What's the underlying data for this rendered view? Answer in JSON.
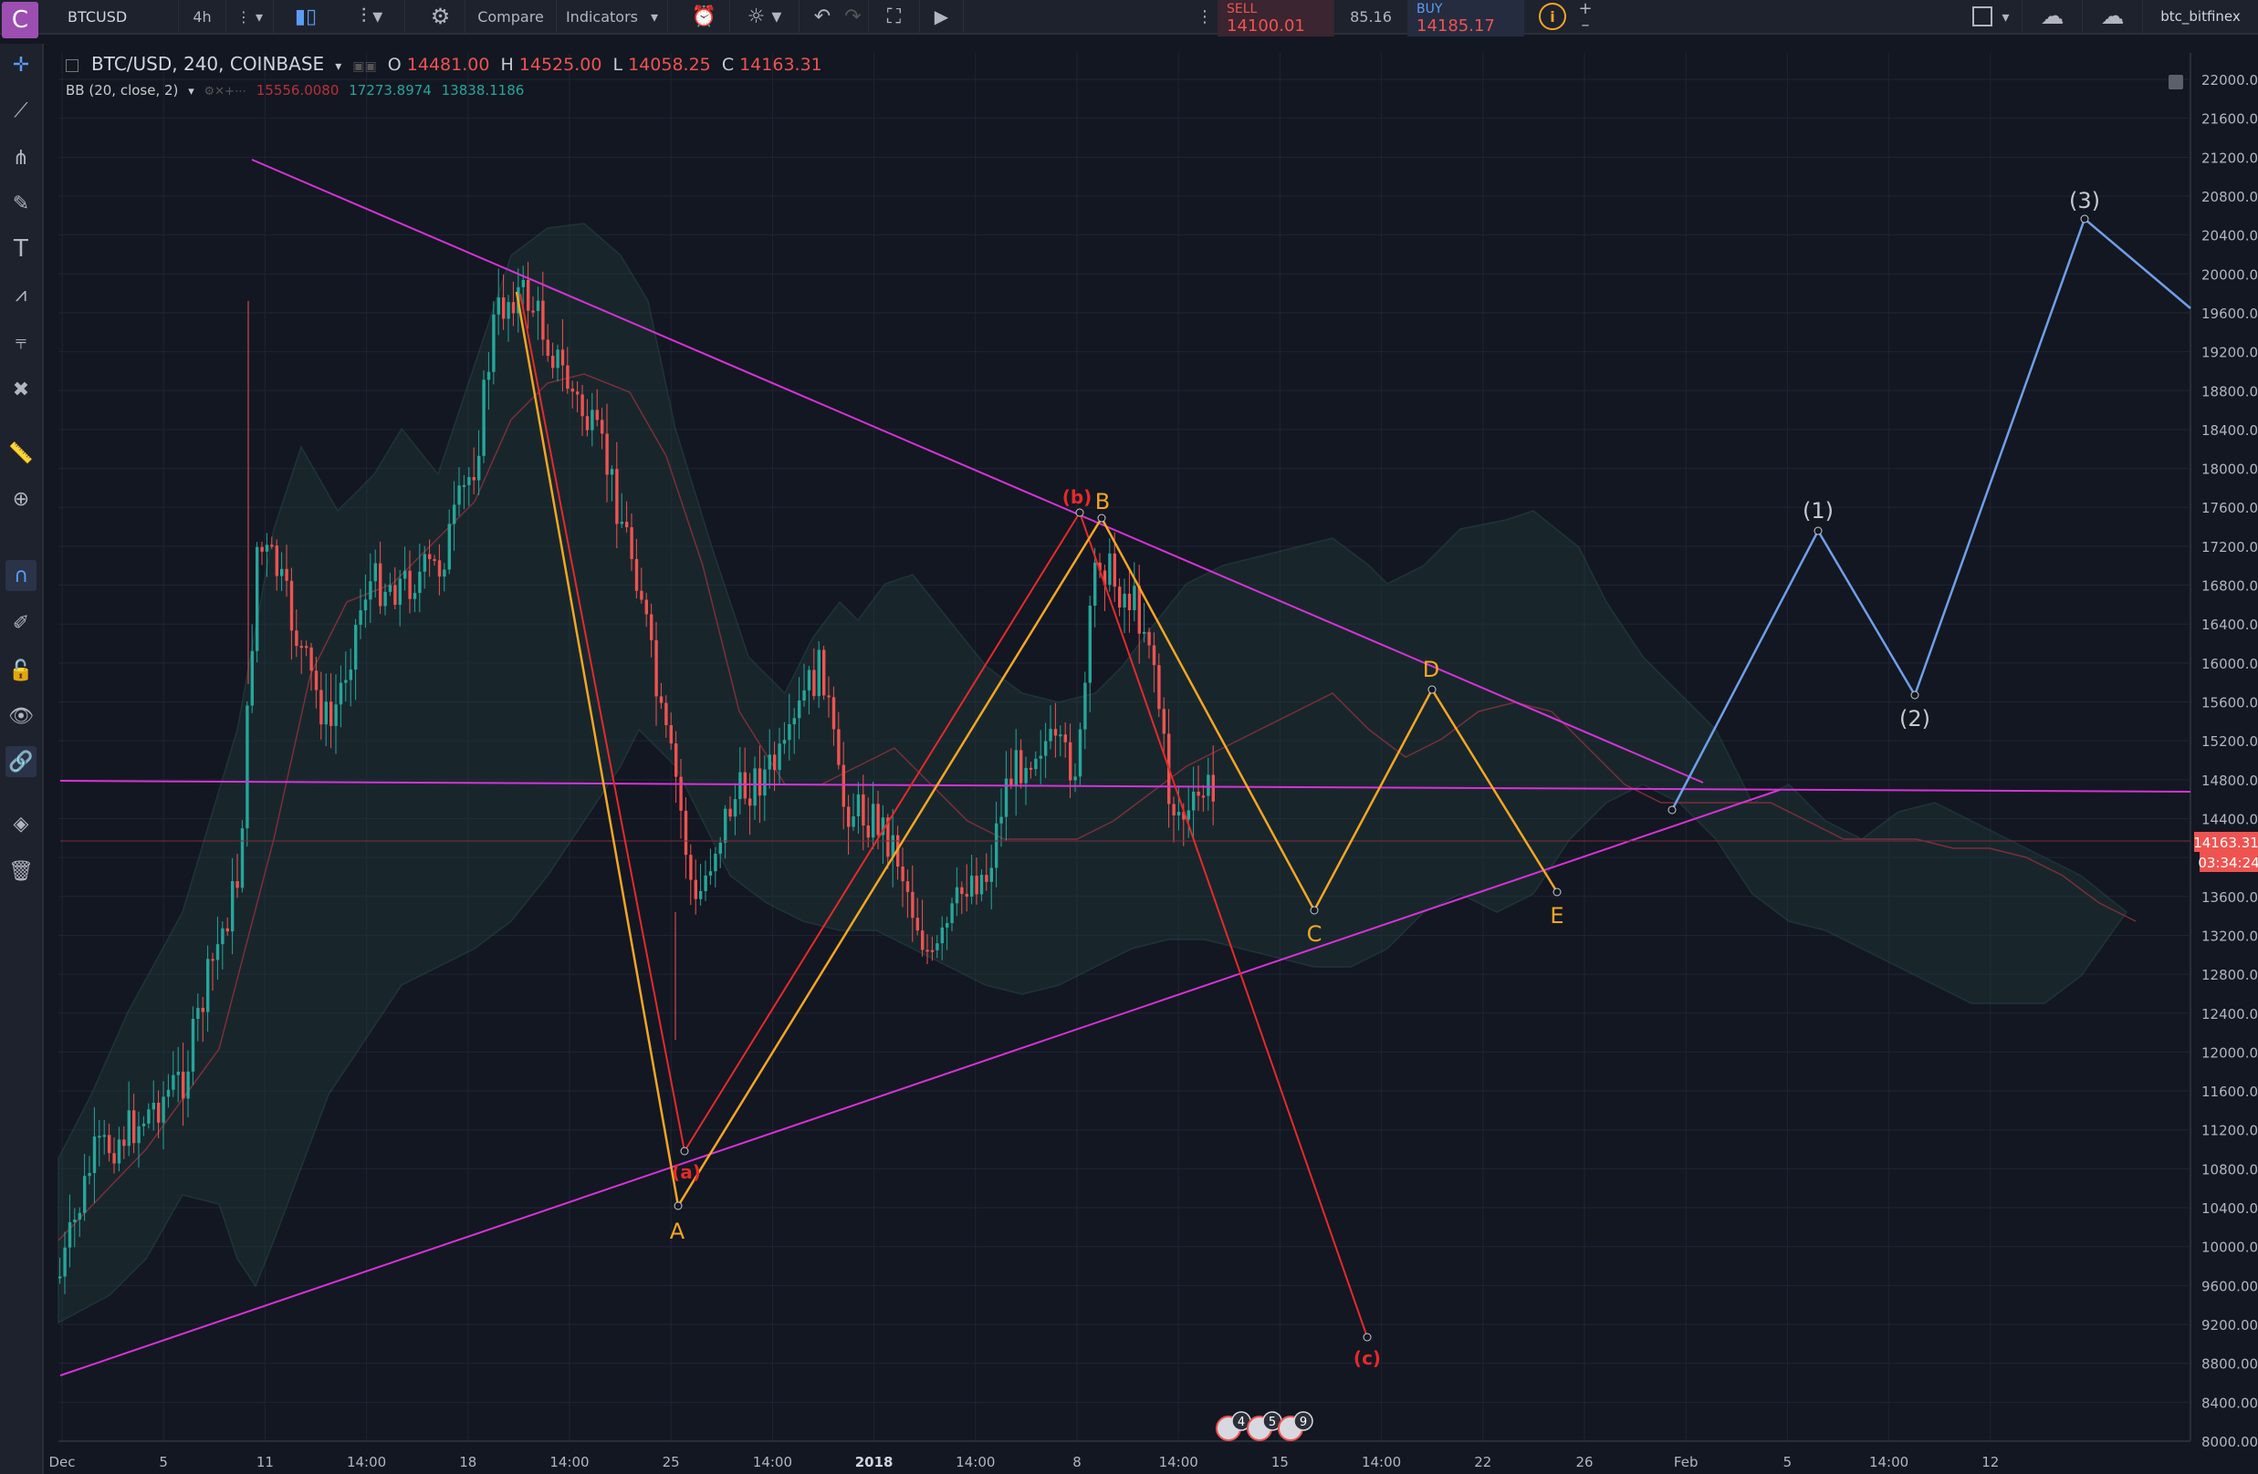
{
  "toolbar": {
    "symbol": "BTCUSD",
    "interval": "4h",
    "compare_label": "Compare",
    "indicators_label": "Indicators",
    "sell_label": "SELL",
    "sell_price": "14100.01",
    "spread": "85.16",
    "buy_label": "BUY",
    "buy_price": "14185.17",
    "username": "btc_bitfinex",
    "logo_letter": "C"
  },
  "legend": {
    "title": "BTC/USD, 240, COINBASE",
    "o_label": "O",
    "o_value": "14481.00",
    "h_label": "H",
    "h_value": "14525.00",
    "l_label": "L",
    "l_value": "14058.25",
    "c_label": "C",
    "c_value": "14163.31",
    "bb_label": "BB (20, close, 2)",
    "bb_basis": "15556.0080",
    "bb_upper": "17273.8974",
    "bb_lower": "13838.1186"
  },
  "price_axis": {
    "ticks": [
      "22000.00",
      "21600.00",
      "21200.00",
      "20800.00",
      "20400.00",
      "20000.00",
      "19600.00",
      "19200.00",
      "18800.00",
      "18400.00",
      "18000.00",
      "17600.00",
      "17200.00",
      "16800.00",
      "16400.00",
      "16000.00",
      "15600.00",
      "15200.00",
      "14800.00",
      "14400.00",
      "14000.00",
      "13600.00",
      "13200.00",
      "12800.00",
      "12400.00",
      "12000.00",
      "11600.00",
      "11200.00",
      "10800.00",
      "10400.00",
      "10000.00",
      "9600.00",
      "9200.00",
      "8800.00",
      "8400.00",
      "8000.00"
    ],
    "last_price": "14163.31",
    "countdown": "03:34:24"
  },
  "time_axis": {
    "labels": [
      "Dec",
      "5",
      "11",
      "14:00",
      "18",
      "14:00",
      "25",
      "14:00",
      "2018",
      "14:00",
      "8",
      "14:00",
      "15",
      "14:00",
      "22",
      "26",
      "Feb",
      "5",
      "14:00",
      "12"
    ]
  },
  "annotations": {
    "wave_A": "A",
    "wave_B": "B",
    "wave_C": "C",
    "wave_D": "D",
    "wave_E": "E",
    "wave_a": "(a)",
    "wave_b": "(b)",
    "wave_c": "(c)",
    "wave_1": "(1)",
    "wave_2": "(2)",
    "wave_3": "(3)"
  },
  "event_badges": [
    "4",
    "5",
    "9"
  ],
  "colors": {
    "background": "#131722",
    "candle_up": "#26a69a",
    "candle_down": "#ef5350",
    "trendline": "#d633d6",
    "wave_orange": "#f5a623",
    "wave_red": "#e52a2a",
    "wave_blue": "#6f9fe8",
    "bb_fill": "#1f3a3a"
  },
  "icons": {
    "crosshair": "crosshair-icon",
    "trend_line": "trend-line-icon",
    "pitchfork": "pitchfork-icon",
    "brush": "brush-icon",
    "text": "text-icon",
    "pattern": "pattern-icon",
    "forecast": "forecast-icon",
    "remove": "close-icon",
    "ruler": "ruler-icon",
    "zoom": "zoom-icon",
    "magnet": "magnet-icon",
    "lock_draw": "pencil-lock-icon",
    "lock": "lock-icon",
    "eye": "eye-icon",
    "link": "link-icon",
    "layers": "layers-icon",
    "trash": "trash-icon"
  }
}
